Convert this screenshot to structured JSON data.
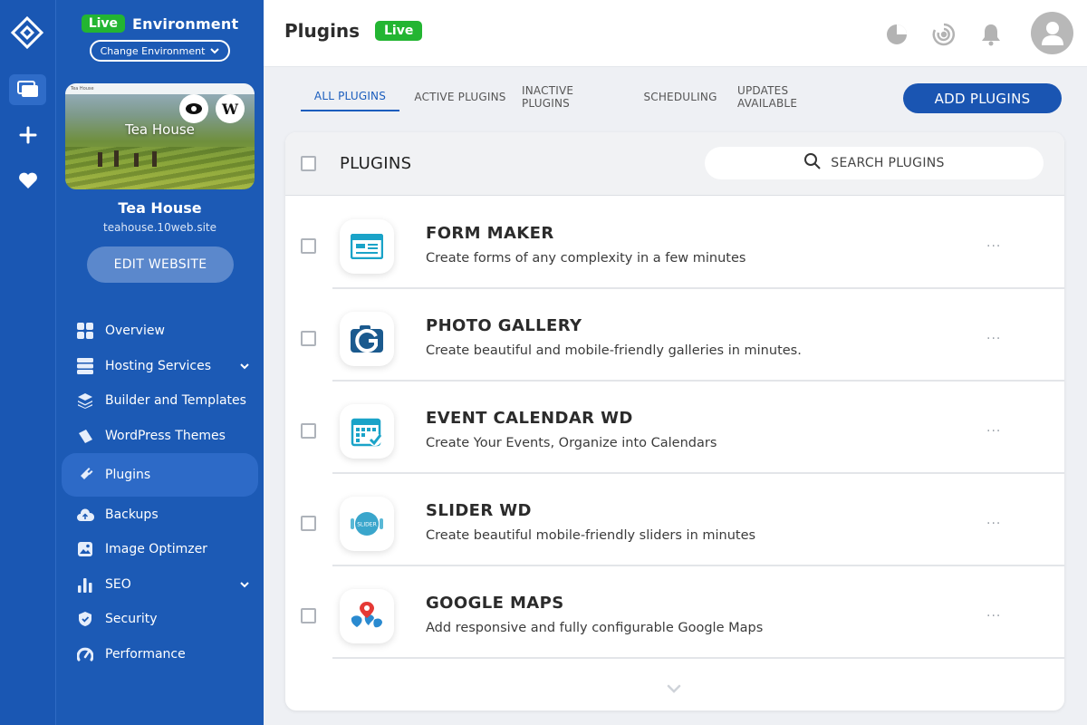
{
  "rail": {
    "items": [
      "logo-icon",
      "websites-icon",
      "add-icon",
      "favorites-icon"
    ]
  },
  "sidebar": {
    "env_badge": "Live",
    "env_title": "Environment",
    "change_env": "Change Environment",
    "thumb_site_title": "Tea House",
    "thumb_topbar": "Tea House",
    "site_name": "Tea House",
    "site_url": "teahouse.10web.site",
    "edit_button": "EDIT WEBSITE",
    "items": [
      {
        "label": "Overview",
        "icon": "grid-icon"
      },
      {
        "label": "Hosting Services",
        "icon": "server-icon",
        "expandable": true
      },
      {
        "label": "Builder and Templates",
        "icon": "layers-icon"
      },
      {
        "label": "WordPress Themes",
        "icon": "theme-icon"
      },
      {
        "label": "Plugins",
        "icon": "plug-icon",
        "active": true
      },
      {
        "label": "Backups",
        "icon": "cloud-icon"
      },
      {
        "label": "Image Optimzer",
        "icon": "image-icon"
      },
      {
        "label": "SEO",
        "icon": "bar-chart-icon",
        "expandable": true
      },
      {
        "label": "Security",
        "icon": "shield-icon"
      },
      {
        "label": "Performance",
        "icon": "gauge-icon"
      }
    ]
  },
  "header": {
    "title": "Plugins",
    "live_badge": "Live",
    "icons": [
      "pie-chart-icon",
      "target-icon",
      "bell-icon",
      "user-avatar-icon"
    ]
  },
  "tabs": [
    {
      "label": "ALL PLUGINS",
      "active": true
    },
    {
      "label": "ACTIVE PLUGINS"
    },
    {
      "label": "INACTIVE PLUGINS"
    },
    {
      "label": "SCHEDULING"
    },
    {
      "label": "UPDATES AVAILABLE"
    }
  ],
  "add_button": "ADD PLUGINS",
  "table": {
    "header_title": "PLUGINS",
    "search_placeholder": "SEARCH PLUGINS",
    "more_label": "···",
    "plugins": [
      {
        "name": "FORM MAKER",
        "description": "Create forms of any complexity in a few minutes",
        "icon": "form-maker-icon"
      },
      {
        "name": "PHOTO GALLERY",
        "description": "Create beautiful and mobile-friendly galleries in minutes.",
        "icon": "photo-gallery-icon"
      },
      {
        "name": "EVENT CALENDAR WD",
        "description": "Create Your Events, Organize into Calendars",
        "icon": "calendar-icon"
      },
      {
        "name": "SLIDER WD",
        "description": "Create beautiful mobile-friendly sliders in minutes",
        "icon": "slider-icon",
        "icon_text": "SLIDER"
      },
      {
        "name": "GOOGLE MAPS",
        "description": "Add responsive and fully configurable Google Maps",
        "icon": "map-pin-icon"
      }
    ]
  },
  "colors": {
    "sidebar": "#1c5ab5",
    "accent": "#1a55b2",
    "live": "#23b532",
    "plugin_icon": "#1aa3c8"
  }
}
